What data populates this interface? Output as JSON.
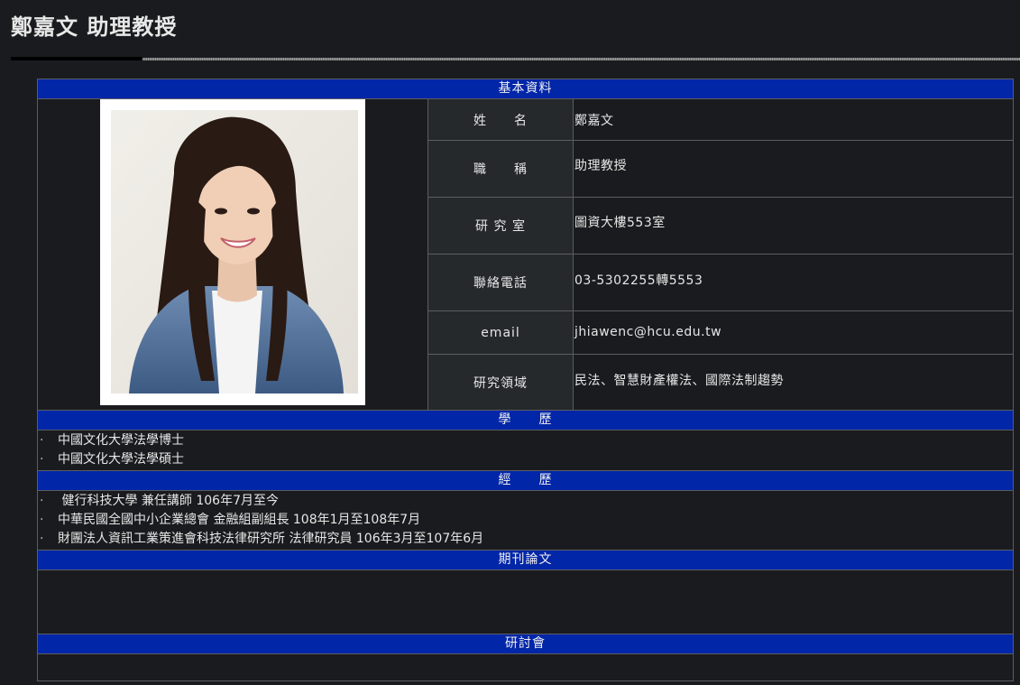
{
  "page": {
    "title": "鄭嘉文 助理教授"
  },
  "sections": {
    "basic": "基本資料",
    "education": "學　　歷",
    "experience": "經　　歷",
    "journal": "期刊論文",
    "seminar": "研討會"
  },
  "profile": {
    "photo_alt": "portrait photo",
    "rows": [
      {
        "label": "姓　　名",
        "value": "鄭嘉文"
      },
      {
        "label": "職　　稱",
        "value": "助理教授"
      },
      {
        "label": "研 究 室",
        "value": "圖資大樓553室"
      },
      {
        "label": "聯絡電話",
        "value": "03-5302255轉5553"
      },
      {
        "label": "email",
        "value": "jhiawenc@hcu.edu.tw"
      },
      {
        "label": "研究領域",
        "value": "民法、智慧財產權法、國際法制趨勢"
      }
    ]
  },
  "education": [
    "中國文化大學法學博士",
    "中國文化大學法學碩士"
  ],
  "experience": [
    " 健行科技大學 兼任講師 106年7月至今",
    "中華民國全國中小企業總會 金融組副組長 108年1月至108年7月",
    "財團法人資訊工業策進會科技法律研究所 法律研究員 106年3月至107年6月"
  ],
  "colors": {
    "band": "#0226a8",
    "background": "#1a1b1e",
    "label_bg": "#26292c"
  }
}
